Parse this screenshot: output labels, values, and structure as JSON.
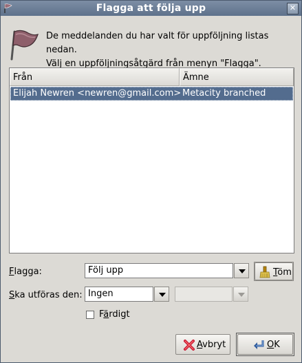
{
  "window": {
    "title": "Flagga att följa upp"
  },
  "info": {
    "line1": "De meddelanden du har valt för uppföljning listas nedan.",
    "line2": "Välj en uppföljningsåtgärd från menyn \"Flagga\"."
  },
  "list": {
    "columns": [
      "Från",
      "Ämne"
    ],
    "rows": [
      {
        "from": "Elijah Newren <newren@gmail.com>",
        "subject": "Metacity branched",
        "selected": true
      }
    ]
  },
  "form": {
    "flag_label_pre": "",
    "flag_label_u": "F",
    "flag_label_post": "lagga:",
    "flag_value": "Följ upp",
    "clear_pre": "",
    "clear_u": "T",
    "clear_post": "öm",
    "due_label_u": "S",
    "due_label_post": "ka utföras den:",
    "due_value": "Ingen",
    "time_value": "",
    "done_pre": "F",
    "done_u": "ä",
    "done_post": "rdigt",
    "done_checked": false
  },
  "buttons": {
    "cancel_pre": "",
    "cancel_u": "A",
    "cancel_post": "vbryt",
    "ok_pre": "",
    "ok_u": "O",
    "ok_post": "K"
  },
  "colors": {
    "titlebar": "#6b7d96",
    "selection": "#536c8e",
    "background": "#dcdad5"
  }
}
